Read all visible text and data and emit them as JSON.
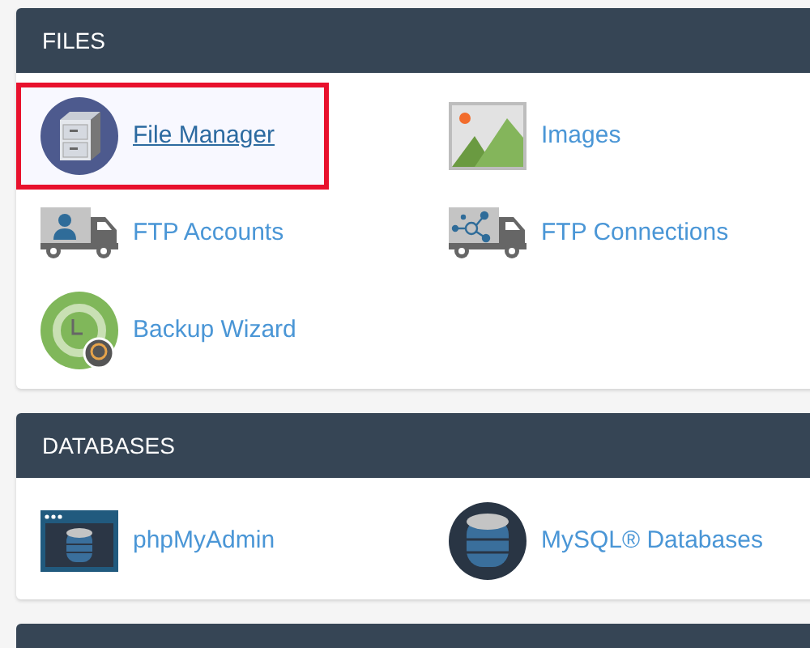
{
  "panels": [
    {
      "title": "FILES",
      "items": [
        {
          "label": "File Manager",
          "kind": "cabinet",
          "selected": true
        },
        {
          "label": "Images",
          "kind": "picture",
          "selected": false
        },
        {
          "label": "FTP Accounts",
          "kind": "truck-user",
          "selected": false
        },
        {
          "label": "FTP Connections",
          "kind": "truck-network",
          "selected": false
        },
        {
          "label": "Backup Wizard",
          "kind": "backup",
          "selected": false
        }
      ]
    },
    {
      "title": "DATABASES",
      "items": [
        {
          "label": "phpMyAdmin",
          "kind": "db-window",
          "selected": false
        },
        {
          "label": "MySQL® Databases",
          "kind": "db-circle",
          "selected": false
        }
      ]
    }
  ]
}
